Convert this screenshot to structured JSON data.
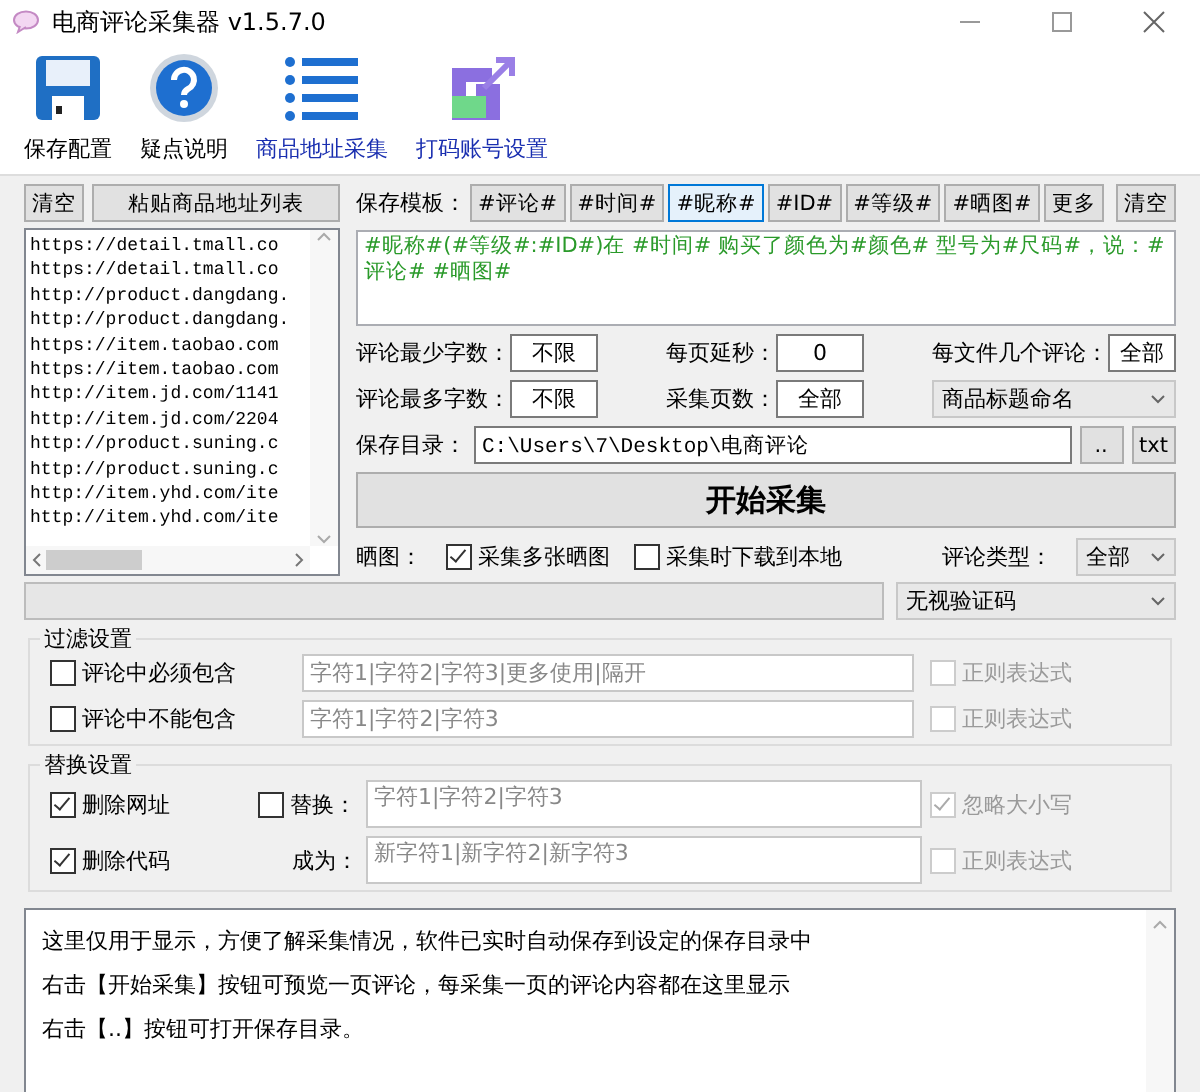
{
  "window": {
    "title": "电商评论采集器 v1.5.7.0"
  },
  "toolbar": [
    {
      "label": "保存配置",
      "kind": "floppy",
      "link": false
    },
    {
      "label": "疑点说明",
      "kind": "help",
      "link": false
    },
    {
      "label": "商品地址采集",
      "kind": "list",
      "link": true
    },
    {
      "label": "打码账号设置",
      "kind": "logo",
      "link": true
    }
  ],
  "url_panel": {
    "clear_button": "清空",
    "paste_button": "粘贴商品地址列表",
    "urls": [
      "https://detail.tmall.co",
      "https://detail.tmall.co",
      "http://product.dangdang.",
      "http://product.dangdang.",
      "https://item.taobao.com",
      "https://item.taobao.com",
      "http://item.jd.com/1141",
      "http://item.jd.com/2204",
      "http://product.suning.c",
      "http://product.suning.c",
      "http://item.yhd.com/ite",
      "http://item.yhd.com/ite"
    ]
  },
  "template": {
    "label": "保存模板：",
    "tags": [
      {
        "label": "#评论#",
        "selected": false
      },
      {
        "label": "#时间#",
        "selected": false
      },
      {
        "label": "#昵称#",
        "selected": true
      },
      {
        "label": "#ID#",
        "selected": false
      },
      {
        "label": "#等级#",
        "selected": false
      },
      {
        "label": "#晒图#",
        "selected": false
      },
      {
        "label": "更多",
        "selected": false
      }
    ],
    "clear_button": "清空",
    "text": "#昵称#(#等级#:#ID#)在 #时间# 购买了颜色为#颜色# 型号为#尺码#，说：#评论# #晒图#"
  },
  "options": [
    [
      {
        "label": "评论最少字数：",
        "value": "不限",
        "kind": "field"
      },
      {
        "label": "每页延秒：",
        "value": "0",
        "kind": "field"
      },
      {
        "label": "每文件几个评论：",
        "value": "全部",
        "kind": "field"
      }
    ],
    [
      {
        "label": "评论最多字数：",
        "value": "不限",
        "kind": "field"
      },
      {
        "label": "采集页数：",
        "value": "全部",
        "kind": "field"
      },
      {
        "value": "商品标题命名",
        "kind": "select"
      }
    ]
  ],
  "save_dir": {
    "label": "保存目录：",
    "value": "C:\\Users\\7\\Desktop\\电商评论",
    "browse_button": "..",
    "format_button": "txt"
  },
  "start_button": "开始采集",
  "images": {
    "label": "晒图：",
    "options": [
      {
        "label": "采集多张晒图",
        "checked": true
      },
      {
        "label": "采集时下载到本地",
        "checked": false
      }
    ],
    "type_label": "评论类型：",
    "type_value": "全部"
  },
  "progress": {
    "level": 0
  },
  "captcha": {
    "value": "无视验证码"
  },
  "filter": {
    "title": "过滤设置",
    "rows": [
      {
        "label": "评论中必须包含",
        "checked": false,
        "placeholder": "字符1|字符2|字符3|更多使用|隔开",
        "regex": {
          "label": "正则表达式",
          "checked": false,
          "disabled": true
        }
      },
      {
        "label": "评论中不能包含",
        "checked": false,
        "placeholder": "字符1|字符2|字符3",
        "regex": {
          "label": "正则表达式",
          "checked": false,
          "disabled": true
        }
      }
    ]
  },
  "replace": {
    "title": "替换设置",
    "removals": [
      {
        "label": "删除网址",
        "checked": true
      },
      {
        "label": "删除代码",
        "checked": true
      }
    ],
    "replace_check": {
      "label": "替换：",
      "checked": false
    },
    "into_label": "成为：",
    "fields": [
      {
        "placeholder": "字符1|字符2|字符3"
      },
      {
        "placeholder": "新字符1|新字符2|新字符3"
      }
    ],
    "options": [
      {
        "label": "忽略大小写",
        "checked": true,
        "disabled": true
      },
      {
        "label": "正则表达式",
        "checked": false,
        "disabled": true
      }
    ]
  },
  "log": {
    "lines": [
      "这里仅用于显示，方便了解采集情况，软件已实时自动保存到设定的保存目录中",
      "右击【开始采集】按钮可预览一页评论，每采集一页的评论内容都在这里显示",
      "右击【..】按钮可打开保存目录。"
    ]
  }
}
